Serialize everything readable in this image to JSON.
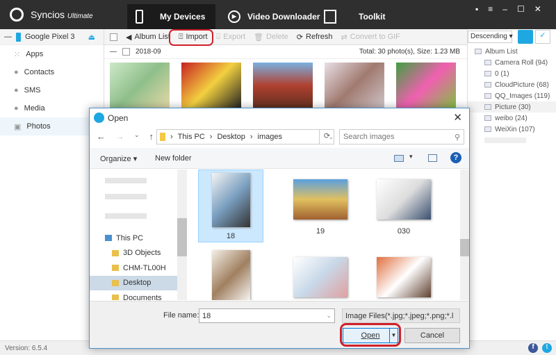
{
  "app": {
    "name": "Syncios",
    "edition": "Ultimate",
    "tabs": [
      {
        "label": "My Devices",
        "icon": "phone-icon"
      },
      {
        "label": "Video Downloader",
        "icon": "play-icon"
      },
      {
        "label": "Toolkit",
        "icon": "toolkit-icon"
      }
    ],
    "window_controls": [
      "feedback",
      "menu",
      "minimize",
      "maximize",
      "close"
    ]
  },
  "device": {
    "name": "Google Pixel 3"
  },
  "sidebar": {
    "items": [
      {
        "label": "Apps",
        "icon": "apps-icon"
      },
      {
        "label": "Contacts",
        "icon": "contacts-icon"
      },
      {
        "label": "SMS",
        "icon": "sms-icon"
      },
      {
        "label": "Media",
        "icon": "media-icon"
      },
      {
        "label": "Photos",
        "icon": "photos-icon"
      }
    ]
  },
  "toolbar": {
    "album_list": "Album List",
    "import": "Import",
    "export": "Export",
    "delete": "Delete",
    "refresh": "Refresh",
    "convert": "Convert to GIF",
    "sort": "Descending"
  },
  "group": {
    "date": "2018-09",
    "summary": "Total: 30 photo(s), Size: 1.23 MB"
  },
  "albums": {
    "header": "Album List",
    "items": [
      "Camera Roll (94)",
      "0 (1)",
      "CloudPicture (68)",
      "QQ_Images (119)",
      "Picture (30)",
      "weibo (24)",
      "WeiXin (107)"
    ],
    "selected": "Picture (30)"
  },
  "status": {
    "version": "Version: 6.5.4"
  },
  "dialog": {
    "title": "Open",
    "path": [
      "This PC",
      "Desktop",
      "images"
    ],
    "search_placeholder": "Search images",
    "organize": "Organize",
    "new_folder": "New folder",
    "nav": [
      {
        "label": "This PC"
      },
      {
        "label": "3D Objects"
      },
      {
        "label": "CHM-TL00H"
      },
      {
        "label": "Desktop",
        "selected": true
      },
      {
        "label": "Documents"
      }
    ],
    "files": [
      {
        "name": "18",
        "selected": true
      },
      {
        "name": "19"
      },
      {
        "name": "030"
      },
      {
        "name": ""
      },
      {
        "name": ""
      },
      {
        "name": ""
      }
    ],
    "file_name_label": "File name:",
    "file_name": "18",
    "file_type": "Image Files(*.jpg;*.jpeg;*.png;*.l",
    "open": "Open",
    "cancel": "Cancel"
  },
  "colors": {
    "accent": "#1ea7e1",
    "highlight": "#d0202a",
    "titlebar": "#2f2f2f"
  }
}
